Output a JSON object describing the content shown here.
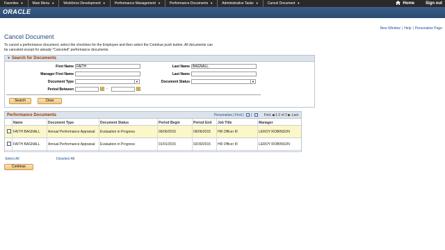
{
  "topnav": {
    "items": [
      {
        "label": "Favorites"
      },
      {
        "label": "Main Menu"
      },
      {
        "label": "Workforce Development"
      },
      {
        "label": "Performance Management"
      },
      {
        "label": "Performance Documents"
      },
      {
        "label": "Administrative Tasks"
      },
      {
        "label": "Cancel Document"
      }
    ],
    "home": "Home",
    "signout": "Sign out"
  },
  "brand": {
    "logo_text": "ORACLE"
  },
  "header_links": {
    "new_window": "New Window",
    "help": "Help",
    "personalize_page": "Personalize Page"
  },
  "page": {
    "title": "Cancel Document",
    "instructions": "To cancel a performance document, select the checkbox for the Employee and then select the Continue push button. All documents can be canceled except for already \"Canceled\" performance documents."
  },
  "search": {
    "header": "Search for Documents",
    "first_name_label": "First Name",
    "first_name_value": "FAITH",
    "last_name_label": "Last Name",
    "last_name_value": "BAGNALL",
    "manager_first_name_label": "Manager First Name",
    "manager_last_name_label": "Last Name",
    "document_type_label": "Document Type",
    "document_status_label": "Document Status",
    "period_between_label": "Period Between",
    "search_button": "Search",
    "clear_button": "Clear"
  },
  "grid": {
    "title": "Performance Documents",
    "personalize": "Personalize",
    "find": "Find",
    "first": "First",
    "range": "1-2 of 2",
    "last": "Last",
    "columns": [
      "Name",
      "Document Type",
      "Document Status",
      "Period Begin",
      "Period End",
      "Job Title",
      "Manager"
    ],
    "rows": [
      {
        "name": "FAITH BAGNALL",
        "doc_type": "Annual Performance Appraisal",
        "status": "Evaluation in Progress",
        "begin": "09/06/2015",
        "end": "09/06/2015",
        "job": "HR Officer III",
        "manager": "LEROY ROBINSON"
      },
      {
        "name": "FAITH BAGNALL",
        "doc_type": "Annual Performance Appraisal",
        "status": "Evaluation in Progress",
        "begin": "01/01/2015",
        "end": "03/30/2015",
        "job": "HR Officer III",
        "manager": "LEROY ROBINSON"
      }
    ]
  },
  "actions": {
    "select_all": "Select All",
    "deselect_all": "Deselect All",
    "continue": "Continue"
  },
  "colors": {
    "nav_bg": "#2a2a2a",
    "brand_bg": "#2b4a70",
    "title_color": "#274c7a",
    "section_header_color": "#9a3a00",
    "highlight_row": "#fcf7c9"
  }
}
